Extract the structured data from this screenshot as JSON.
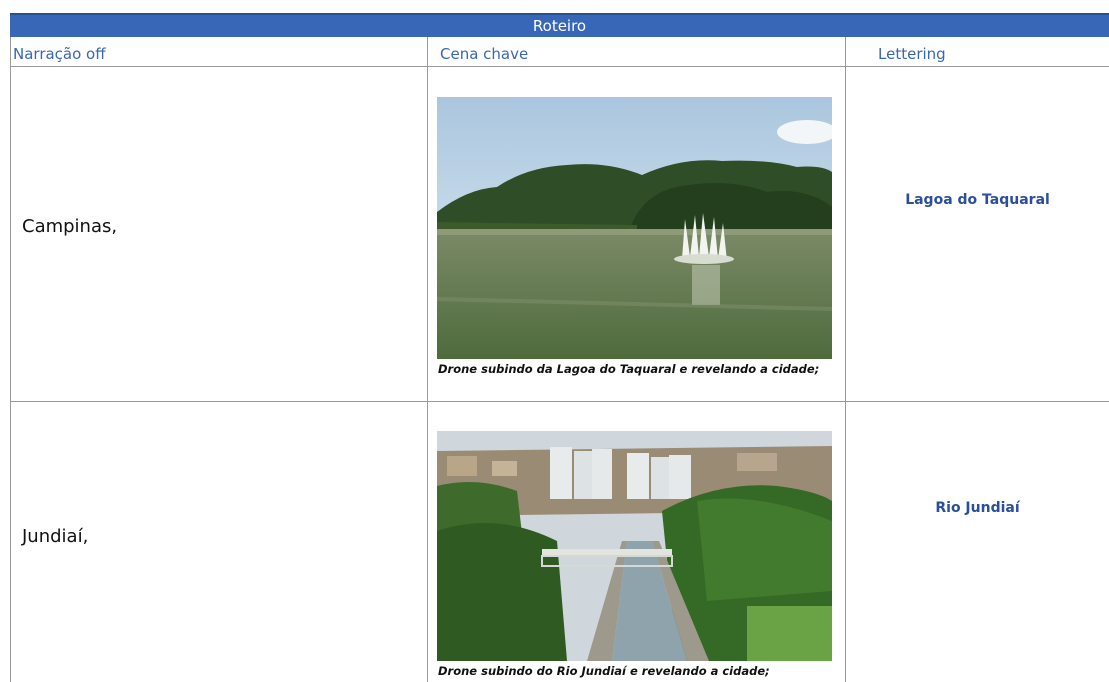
{
  "title": "Roteiro",
  "columns": {
    "narration": "Narração off",
    "key_scene": "Cena chave",
    "lettering": "Lettering"
  },
  "rows": [
    {
      "narration": "Campinas,",
      "caption": "Drone subindo da Lagoa do Taquaral e revelando a cidade;",
      "lettering": "Lagoa do Taquaral",
      "photo": "lake-with-fountain-photo"
    },
    {
      "narration": "Jundiaí,",
      "caption": "Drone subindo do Rio Jundiaí e revelando a cidade;",
      "lettering": "Rio Jundiaí",
      "photo": "river-canal-city-photo"
    }
  ],
  "colors": {
    "title_bg": "#3867b8",
    "header_text": "#3867b8",
    "lettering_text": "#2b4f9a"
  }
}
